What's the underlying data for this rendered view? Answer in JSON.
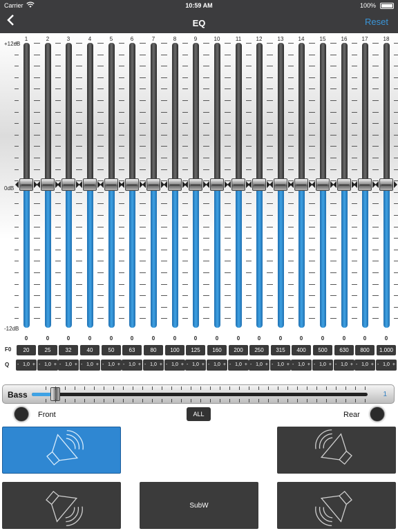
{
  "status_bar": {
    "carrier": "Carrier",
    "time": "10:59 AM",
    "battery": "100%"
  },
  "nav": {
    "back_icon": "chevron-left-icon",
    "title": "EQ",
    "reset_label": "Reset"
  },
  "eq": {
    "db_max": "+12dB",
    "db_mid": "0dB",
    "db_min": "-12dB",
    "channels": [
      "1",
      "2",
      "3",
      "4",
      "5",
      "6",
      "7",
      "8",
      "9",
      "10",
      "11",
      "12",
      "13",
      "14",
      "15",
      "16",
      "17",
      "18"
    ],
    "gains": [
      "0",
      "0",
      "0",
      "0",
      "0",
      "0",
      "0",
      "0",
      "0",
      "0",
      "0",
      "0",
      "0",
      "0",
      "0",
      "0",
      "0",
      "0"
    ],
    "f0_label": "F0",
    "f0": [
      "20",
      "25",
      "32",
      "40",
      "50",
      "63",
      "80",
      "100",
      "125",
      "160",
      "200",
      "250",
      "315",
      "400",
      "500",
      "630",
      "800",
      "1.000"
    ],
    "q_label": "Q",
    "q": [
      "1,0",
      "1,0",
      "1,0",
      "1,0",
      "1,0",
      "1,0",
      "1,0",
      "1,0",
      "1,0",
      "1,0",
      "1,0",
      "1,0",
      "1,0",
      "1,0",
      "1,0",
      "1,0",
      "1,0",
      "1,0"
    ],
    "q_minus": "-",
    "q_plus": "+"
  },
  "bass": {
    "label": "Bass",
    "value": "1",
    "level_fraction": 0.06
  },
  "front_rear": {
    "front_label": "Front",
    "all_label": "ALL",
    "rear_label": "Rear"
  },
  "speakers": {
    "front_left_icon": "speaker-front-left-icon",
    "front_right_icon": "speaker-front-right-icon",
    "rear_left_icon": "speaker-rear-left-icon",
    "subwoofer_label": "SubW",
    "rear_right_icon": "speaker-rear-right-icon"
  },
  "colors": {
    "accent": "#3a95d8",
    "active_speaker": "#2f87d2",
    "topbar": "#3c3c3e",
    "panel": "#3b3b3b"
  }
}
